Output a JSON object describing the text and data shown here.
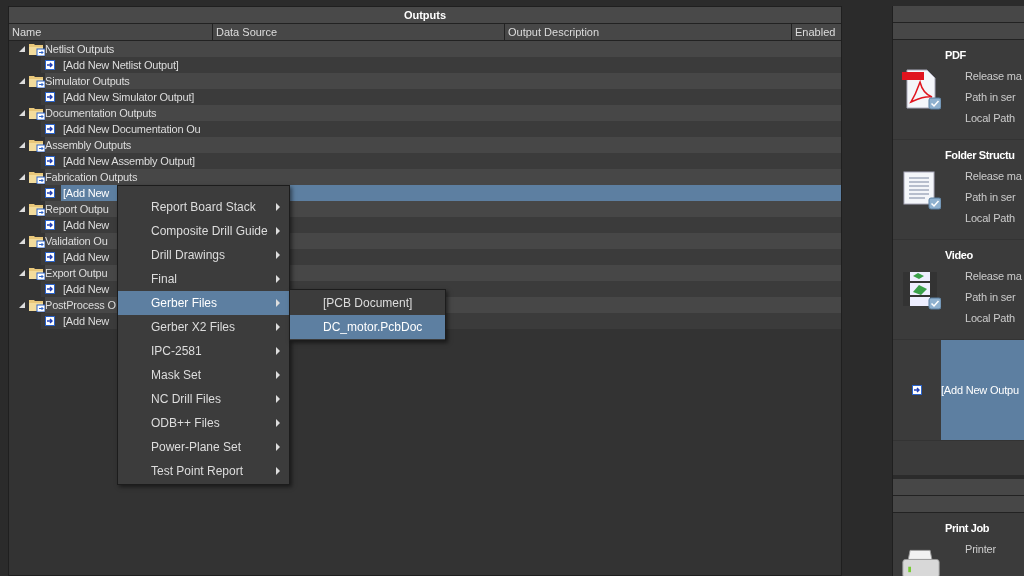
{
  "outputs_panel": {
    "title": "Outputs",
    "columns": [
      "Name",
      "Data Source",
      "Output Description",
      "Enabled"
    ],
    "groups": [
      {
        "name": "Netlist Outputs",
        "expanded": true,
        "children": [
          {
            "name": "[Add New Netlist Output]",
            "selected": false
          }
        ]
      },
      {
        "name": "Simulator Outputs",
        "expanded": true,
        "children": [
          {
            "name": "[Add New Simulator Output]",
            "selected": false
          }
        ]
      },
      {
        "name": "Documentation Outputs",
        "expanded": true,
        "children": [
          {
            "name": "[Add New Documentation Ou",
            "selected": false
          }
        ]
      },
      {
        "name": "Assembly Outputs",
        "expanded": true,
        "children": [
          {
            "name": "[Add New Assembly Output]",
            "selected": false
          }
        ]
      },
      {
        "name": "Fabrication Outputs",
        "expanded": true,
        "children": [
          {
            "name": "[Add New",
            "selected": true
          }
        ]
      },
      {
        "name": "Report Outpu",
        "expanded": true,
        "children": [
          {
            "name": "[Add New",
            "selected": false
          }
        ]
      },
      {
        "name": "Validation Ou",
        "expanded": true,
        "children": [
          {
            "name": "[Add New",
            "selected": false
          }
        ]
      },
      {
        "name": "Export Outpu",
        "expanded": true,
        "children": [
          {
            "name": "[Add New",
            "selected": false
          }
        ]
      },
      {
        "name": "PostProcess O",
        "expanded": true,
        "children": [
          {
            "name": "[Add New",
            "selected": false
          }
        ]
      }
    ]
  },
  "context_menu": {
    "items": [
      {
        "label": "Report Board Stack",
        "selected": false
      },
      {
        "label": "Composite Drill Guide",
        "selected": false
      },
      {
        "label": "Drill Drawings",
        "selected": false
      },
      {
        "label": "Final",
        "selected": false
      },
      {
        "label": "Gerber Files",
        "selected": true
      },
      {
        "label": "Gerber X2 Files",
        "selected": false
      },
      {
        "label": "IPC-2581",
        "selected": false
      },
      {
        "label": "Mask Set",
        "selected": false
      },
      {
        "label": "NC Drill Files",
        "selected": false
      },
      {
        "label": "ODB++ Files",
        "selected": false
      },
      {
        "label": "Power-Plane Set",
        "selected": false
      },
      {
        "label": "Test Point Report",
        "selected": false
      }
    ],
    "submenu": {
      "items": [
        {
          "label": "[PCB Document]",
          "selected": false
        },
        {
          "label": "DC_motor.PcbDoc",
          "selected": true
        }
      ]
    }
  },
  "release_panel": {
    "outputs": [
      {
        "kind": "pdf",
        "title": "PDF",
        "fields": [
          "Release ma",
          "Path in ser",
          "Local Path"
        ]
      },
      {
        "kind": "document",
        "title": "Folder Structu",
        "fields": [
          "Release ma",
          "Path in ser",
          "Local Path"
        ]
      },
      {
        "kind": "video",
        "title": "Video",
        "fields": [
          "Release ma",
          "Path in ser",
          "Local Path"
        ]
      }
    ],
    "add_output": {
      "label": "[Add New Outpu",
      "selected": true
    },
    "print_job": {
      "kind": "printer",
      "title": "Print Job",
      "fields": [
        "Printer"
      ]
    }
  }
}
